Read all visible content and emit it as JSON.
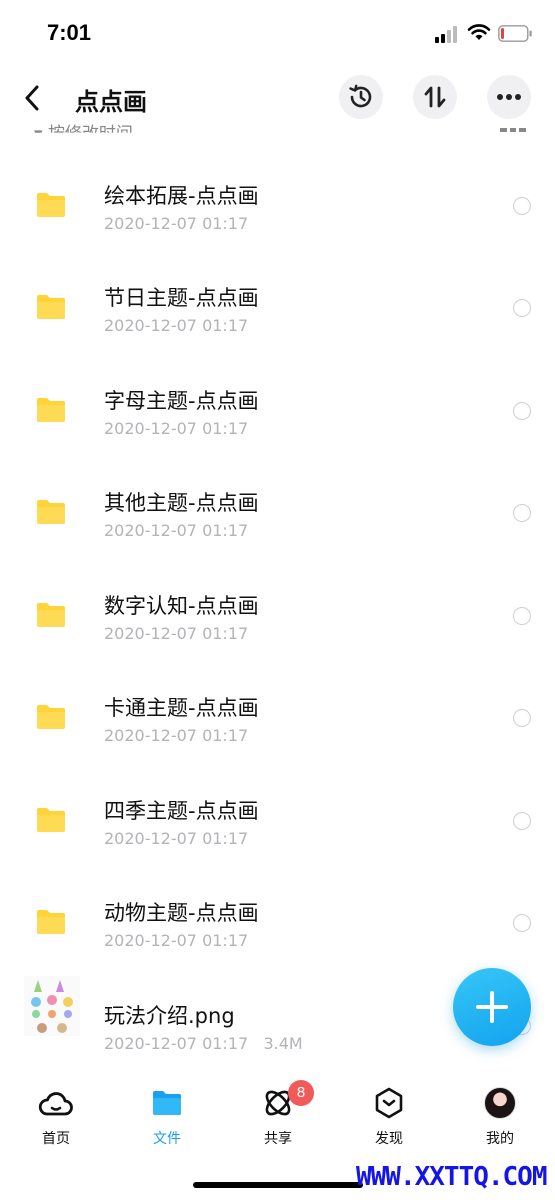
{
  "status_bar": {
    "time": "7:01"
  },
  "header": {
    "title": "点点画"
  },
  "sort": {
    "label": "按修改时间"
  },
  "files": [
    {
      "name": "绘本拓展-点点画",
      "meta": "2020-12-07 01:17",
      "type": "folder"
    },
    {
      "name": "节日主题-点点画",
      "meta": "2020-12-07 01:17",
      "type": "folder"
    },
    {
      "name": "字母主题-点点画",
      "meta": "2020-12-07 01:17",
      "type": "folder"
    },
    {
      "name": "其他主题-点点画",
      "meta": "2020-12-07 01:17",
      "type": "folder"
    },
    {
      "name": "数字认知-点点画",
      "meta": "2020-12-07 01:17",
      "type": "folder"
    },
    {
      "name": "卡通主题-点点画",
      "meta": "2020-12-07 01:17",
      "type": "folder"
    },
    {
      "name": "四季主题-点点画",
      "meta": "2020-12-07 01:17",
      "type": "folder"
    },
    {
      "name": "动物主题-点点画",
      "meta": "2020-12-07 01:17",
      "type": "folder"
    },
    {
      "name": "玩法介绍.png",
      "meta": "2020-12-07 01:17",
      "size": "3.4M",
      "type": "image"
    }
  ],
  "tabs": [
    {
      "label": "首页",
      "icon": "cloud-icon"
    },
    {
      "label": "文件",
      "icon": "folder-icon"
    },
    {
      "label": "共享",
      "icon": "share-orbit-icon",
      "badge": "8"
    },
    {
      "label": "发现",
      "icon": "discover-box-icon"
    },
    {
      "label": "我的",
      "icon": "avatar"
    }
  ],
  "watermark": "WWW.XXTTQ.COM",
  "colors": {
    "accent": "#1a9cf0",
    "folder": "#ffd43b",
    "badge": "#f25a5a"
  }
}
